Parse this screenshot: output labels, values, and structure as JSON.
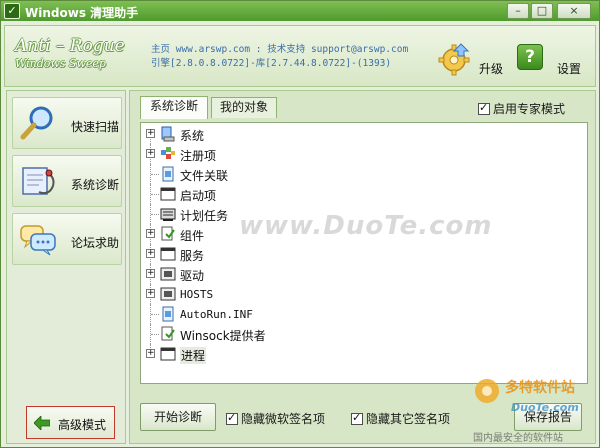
{
  "window": {
    "title": "Windows 清理助手",
    "minimize_label": "–",
    "maximize_label": "□",
    "close_label": "×"
  },
  "header": {
    "logo_line1": "Anti – Rogue",
    "logo_line2": "Windows Sweep",
    "info_line1": "主页 www.arswp.com : 技术支持 support@arswp.com",
    "info_line2": "引擎[2.8.0.8.0722]-库[2.7.44.8.0722]-(1393)",
    "upgrade_label": "升级",
    "settings_label": "设置",
    "settings_icon_glyph": "?"
  },
  "sidebar": {
    "items": [
      {
        "label": "快速扫描",
        "icon": "magnifier-icon"
      },
      {
        "label": "系统诊断",
        "icon": "stethoscope-icon"
      },
      {
        "label": "论坛求助",
        "icon": "speech-bubble-icon"
      }
    ],
    "advanced_label": "高级模式"
  },
  "main": {
    "tabs": [
      {
        "label": "系统诊断",
        "active": true
      },
      {
        "label": "我的对象",
        "active": false
      }
    ],
    "expert_mode_label": "启用专家模式",
    "expert_mode_checked": true,
    "tree": [
      {
        "label": "系统",
        "icon": "system-icon",
        "expandable": true
      },
      {
        "label": "注册项",
        "icon": "registry-icon",
        "expandable": true
      },
      {
        "label": "文件关联",
        "icon": "file-assoc-icon",
        "expandable": false
      },
      {
        "label": "启动项",
        "icon": "window-icon",
        "expandable": false
      },
      {
        "label": "计划任务",
        "icon": "scheduled-task-icon",
        "expandable": false
      },
      {
        "label": "组件",
        "icon": "component-icon",
        "expandable": true
      },
      {
        "label": "服务",
        "icon": "window-icon",
        "expandable": true
      },
      {
        "label": "驱动",
        "icon": "driver-icon",
        "expandable": true
      },
      {
        "label": "HOSTS",
        "icon": "hosts-icon",
        "expandable": true
      },
      {
        "label": "AutoRun.INF",
        "icon": "autorun-icon",
        "expandable": false
      },
      {
        "label": "Winsock提供者",
        "icon": "winsock-icon",
        "expandable": false
      },
      {
        "label": "进程",
        "icon": "window-icon",
        "expandable": true
      }
    ],
    "start_button": "开始诊断",
    "hide_microsoft_label": "隐藏微软签名项",
    "hide_microsoft_checked": true,
    "hide_other_label": "隐藏其它签名项",
    "hide_other_checked": true,
    "save_button": "保存报告"
  },
  "watermark": {
    "center": "www.DuoTe.com",
    "brand": "多特软件站",
    "brand_site": "DuoTe.com",
    "brand_tagline": "国内最安全的软件站"
  },
  "colors": {
    "title_bar": "#5aa534",
    "frame_bg": "#e6efdc",
    "link_blue": "#3b6ea8",
    "highlight_border": "#c0392b"
  }
}
